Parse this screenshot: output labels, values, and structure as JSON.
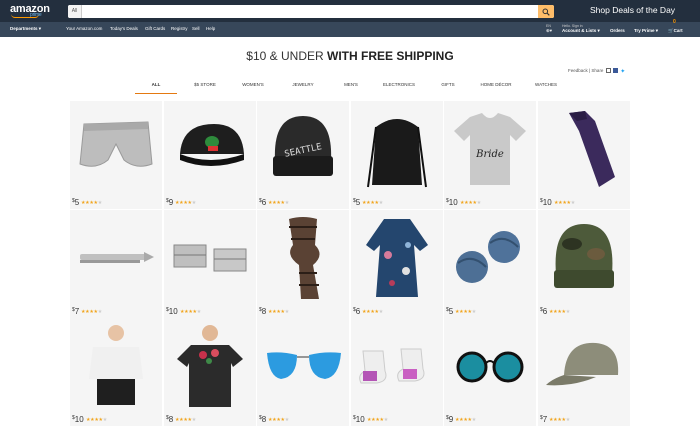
{
  "header": {
    "logo": "amazon",
    "logo_sub": "prime",
    "search_category": "All",
    "deal": "Shop Deals of the Day",
    "lang": "EN",
    "hello": "Hello. Sign in",
    "account": "Account & Lists",
    "orders": "Orders",
    "prime": "Try Prime",
    "cart_count": "0",
    "cart": "Cart"
  },
  "nav": {
    "departments": "Departments",
    "links": [
      "Your Amazon.com",
      "Today's Deals",
      "Gift Cards",
      "Registry",
      "Sell",
      "Help"
    ]
  },
  "page": {
    "title_part1": "$10 & UNDER ",
    "title_part2": "WITH FREE SHIPPING",
    "feedback": "Feedback | Share"
  },
  "tabs": [
    "ALL",
    "$5 STORE",
    "WOMEN'S",
    "JEWELRY",
    "MEN'S",
    "ELECTRONICS",
    "GIFTS",
    "HOME DÉCOR",
    "WATCHES"
  ],
  "products": [
    {
      "name": "gray-shorts",
      "price": "5",
      "stars": 4
    },
    {
      "name": "frog-cap",
      "price": "9",
      "stars": 4
    },
    {
      "name": "seattle-beanie",
      "price": "6",
      "stars": 4
    },
    {
      "name": "drawstring-bag",
      "price": "5",
      "stars": 4
    },
    {
      "name": "bride-tshirt",
      "price": "10",
      "stars": 4
    },
    {
      "name": "purple-tie",
      "price": "10",
      "stars": 4
    },
    {
      "name": "tie-clip",
      "price": "7",
      "stars": 4
    },
    {
      "name": "cufflinks",
      "price": "10",
      "stars": 4
    },
    {
      "name": "plaid-scarf",
      "price": "8",
      "stars": 4
    },
    {
      "name": "floral-kimono",
      "price": "6",
      "stars": 4
    },
    {
      "name": "knot-cufflinks",
      "price": "5",
      "stars": 4
    },
    {
      "name": "camo-beanie",
      "price": "6",
      "stars": 4
    },
    {
      "name": "cold-shoulder-top",
      "price": "10",
      "stars": 4
    },
    {
      "name": "floral-tee",
      "price": "8",
      "stars": 4
    },
    {
      "name": "aviator-sunglasses",
      "price": "8",
      "stars": 4
    },
    {
      "name": "ankle-socks",
      "price": "10",
      "stars": 4
    },
    {
      "name": "round-sunglasses",
      "price": "9",
      "stars": 4
    },
    {
      "name": "baseball-cap",
      "price": "7",
      "stars": 4
    }
  ]
}
